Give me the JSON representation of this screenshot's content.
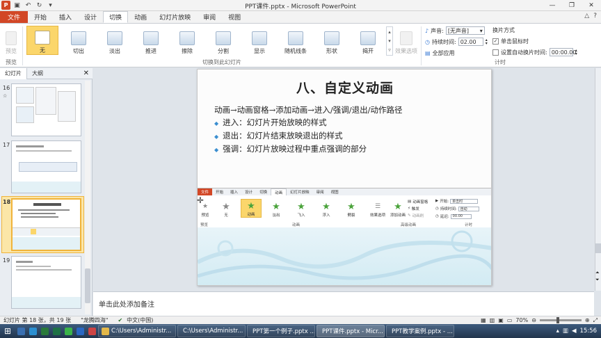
{
  "window": {
    "title": "PPT课件.pptx - Microsoft PowerPoint"
  },
  "qat": {
    "icons": [
      "ppt-logo-icon",
      "save-icon",
      "undo-icon",
      "redo-icon",
      "dropdown-icon"
    ]
  },
  "tabs": [
    {
      "label": "文件"
    },
    {
      "label": "开始"
    },
    {
      "label": "插入"
    },
    {
      "label": "设计"
    },
    {
      "label": "切换"
    },
    {
      "label": "动画"
    },
    {
      "label": "幻灯片放映"
    },
    {
      "label": "审阅"
    },
    {
      "label": "视图"
    }
  ],
  "ribbon": {
    "preview": {
      "label": "预览",
      "group": "预览"
    },
    "transitions": [
      {
        "label": "无"
      },
      {
        "label": "切出"
      },
      {
        "label": "淡出"
      },
      {
        "label": "推进"
      },
      {
        "label": "擦除"
      },
      {
        "label": "分割"
      },
      {
        "label": "显示"
      },
      {
        "label": "随机线条"
      },
      {
        "label": "形状"
      },
      {
        "label": "揭开"
      }
    ],
    "transitions_group": "切换到此幻灯片",
    "effect_options": "效果选项",
    "sound_label": "声音:",
    "sound_value": "[无声音]",
    "duration_label": "持续时间:",
    "duration_value": "02.00",
    "apply_all": "全部应用",
    "advance_title": "换片方式",
    "on_click": "单击鼠标时",
    "auto_after": "设置自动换片时间:",
    "auto_value": "00:00.00",
    "timing_group": "计时"
  },
  "leftpanel": {
    "tabs": [
      "幻灯片",
      "大纲"
    ],
    "slide_numbers": [
      "16",
      "17",
      "18",
      "19"
    ],
    "selected": "18"
  },
  "slide": {
    "title": "八、自定义动画",
    "lines": [
      "动画→动画窗格→添加动画→进入/强调/退出/动作路径",
      "进入：幻灯片开始放映的样式",
      "退出：幻灯片结束放映退出的样式",
      "强调：幻灯片放映过程中重点强调的部分"
    ],
    "shot": {
      "tabs": [
        "文件",
        "开始",
        "插入",
        "设计",
        "切换",
        "动画",
        "幻灯片放映",
        "审阅",
        "视图"
      ],
      "preview": "预览",
      "buttons": [
        "无",
        "动画",
        "淡出",
        "飞入",
        "浮入",
        "劈裂"
      ],
      "effect": "效果选项",
      "add_anim": "添加动画",
      "anim_pane": "动画窗格",
      "trigger": "触发",
      "anim_brush": "动画刷",
      "start_label": "开始:",
      "start_value": "单击时",
      "duration_label": "持续时间:",
      "duration_value": "自动",
      "delay_label": "延迟:",
      "delay_value": "00.00",
      "group_preview": "预览",
      "group_anim": "动画",
      "group_adv": "高级动画",
      "group_timing": "计时"
    }
  },
  "notes": {
    "placeholder": "单击此处添加备注"
  },
  "status": {
    "slide_info": "幻灯片 第 18 张，共 19 张",
    "theme": "\"龙腾四海\"",
    "language": "中文(中国)",
    "zoom": "70%"
  },
  "taskbar": {
    "items": [
      {
        "label": "C:\\Users\\Administr..."
      },
      {
        "label": "C:\\Users\\Administr..."
      },
      {
        "label": "PPT第一个例子.pptx ..."
      },
      {
        "label": "PPT课件.pptx - Micr..."
      },
      {
        "label": "PPT教学案例.pptx - ..."
      }
    ],
    "time": "15:56"
  }
}
